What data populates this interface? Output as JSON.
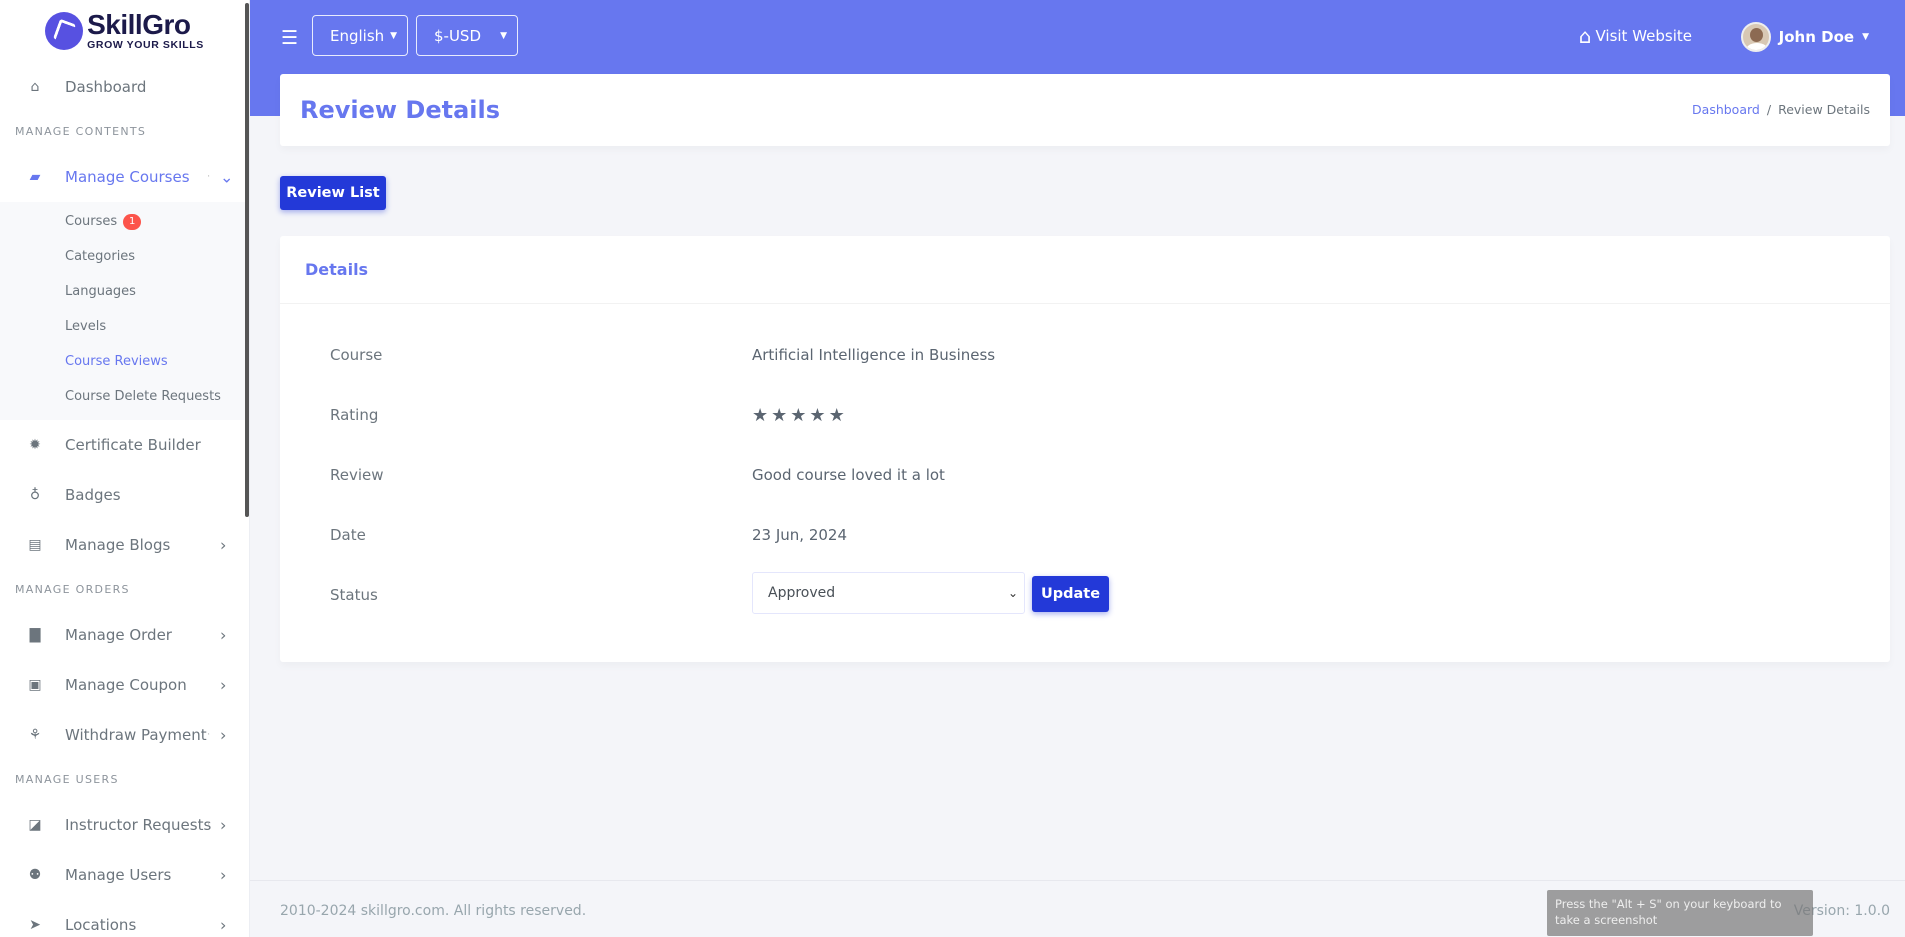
{
  "brand": {
    "name": "SkillGro",
    "tagline": "GROW YOUR SKILLS"
  },
  "sidebar": {
    "dashboard": "Dashboard",
    "header_contents": "MANAGE CONTENTS",
    "manage_courses": "Manage Courses",
    "submenu": {
      "courses": "Courses",
      "courses_badge": "1",
      "categories": "Categories",
      "languages": "Languages",
      "levels": "Levels",
      "course_reviews": "Course Reviews",
      "course_delete_requests": "Course Delete Requests"
    },
    "certificate_builder": "Certificate Builder",
    "badges": "Badges",
    "manage_blogs": "Manage Blogs",
    "header_orders": "MANAGE ORDERS",
    "manage_order": "Manage Order",
    "manage_coupon": "Manage Coupon",
    "withdraw_payment": "Withdraw Payment",
    "header_users": "MANAGE USERS",
    "instructor_requests": "Instructor Requests",
    "manage_users": "Manage Users",
    "locations": "Locations"
  },
  "topbar": {
    "language": "English",
    "currency": "$-USD",
    "visit_website": "Visit Website",
    "user_name": "John Doe"
  },
  "header": {
    "title": "Review Details",
    "breadcrumb_home": "Dashboard",
    "breadcrumb_sep": "/",
    "breadcrumb_current": "Review Details"
  },
  "actions": {
    "review_list": "Review List",
    "update": "Update"
  },
  "details": {
    "title": "Details",
    "course_label": "Course",
    "course_value": "Artificial Intelligence in Business",
    "rating_label": "Rating",
    "rating_value": 5,
    "review_label": "Review",
    "review_value": "Good course loved it a lot",
    "date_label": "Date",
    "date_value": "23 Jun, 2024",
    "status_label": "Status",
    "status_value": "Approved"
  },
  "footer": {
    "copyright": "2010-2024 skillgro.com. All rights reserved.",
    "version": "Version: 1.0.0",
    "tooltip": "Press the \"Alt + S\" on your keyboard to take a screenshot"
  },
  "colors": {
    "primary": "#6777ef",
    "button": "#2339d8",
    "star": "#f7941d",
    "badge": "#fc544b"
  }
}
